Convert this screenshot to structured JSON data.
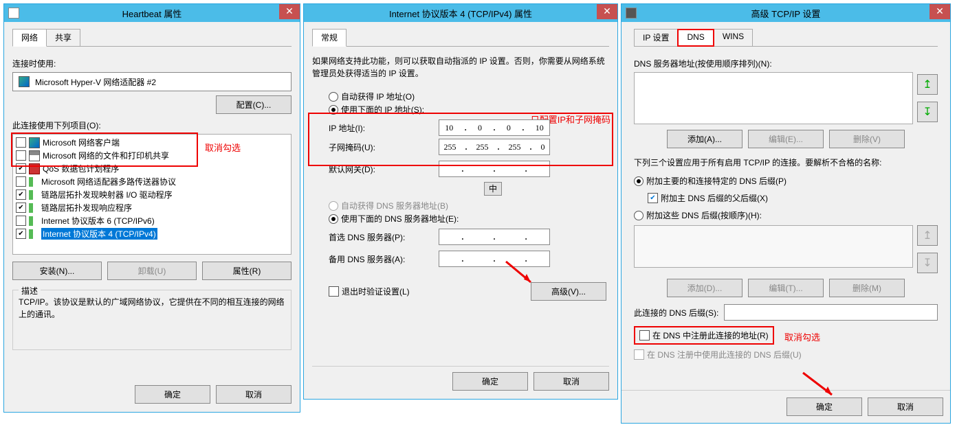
{
  "win1": {
    "title": "Heartbeat 属性",
    "tabs": [
      "网络",
      "共享"
    ],
    "connect_lbl": "连接时使用:",
    "adapter": "Microsoft Hyper-V 网络适配器 #2",
    "config_btn": "配置(C)...",
    "items_lbl": "此连接使用下列项目(O):",
    "note1": "取消勾选",
    "components": [
      {
        "checked": false,
        "icon": "net",
        "text": "Microsoft 网络客户端"
      },
      {
        "checked": false,
        "icon": "prn",
        "text": "Microsoft 网络的文件和打印机共享"
      },
      {
        "checked": true,
        "icon": "red",
        "text": "QoS 数据包计划程序"
      },
      {
        "checked": false,
        "icon": "grn",
        "text": "Microsoft 网络适配器多路传送器协议"
      },
      {
        "checked": true,
        "icon": "grn",
        "text": "链路层拓扑发现映射器 I/O 驱动程序"
      },
      {
        "checked": true,
        "icon": "grn",
        "text": "链路层拓扑发现响应程序"
      },
      {
        "checked": false,
        "icon": "grn",
        "text": "Internet 协议版本 6 (TCP/IPv6)"
      },
      {
        "checked": true,
        "icon": "grn",
        "text": "Internet 协议版本 4 (TCP/IPv4)",
        "selected": true
      }
    ],
    "install": "安装(N)...",
    "uninstall": "卸载(U)",
    "properties": "属性(R)",
    "desc_lbl": "描述",
    "desc": "TCP/IP。该协议是默认的广域网络协议，它提供在不同的相互连接的网络上的通讯。",
    "ok": "确定",
    "cancel": "取消"
  },
  "win2": {
    "title": "Internet 协议版本 4 (TCP/IPv4) 属性",
    "tab": "常规",
    "intro": "如果网络支持此功能，则可以获取自动指派的 IP 设置。否则，你需要从网络系统管理员处获得适当的 IP 设置。",
    "note2": "只配置IP和子网掩码",
    "r1": "自动获得 IP 地址(O)",
    "r2": "使用下面的 IP 地址(S):",
    "ip_lbl": "IP 地址(I):",
    "ip": [
      "10",
      "0",
      "0",
      "10"
    ],
    "mask_lbl": "子网掩码(U):",
    "mask": [
      "255",
      "255",
      "255",
      "0"
    ],
    "gw_lbl": "默认网关(D):",
    "r3": "自动获得 DNS 服务器地址(B)",
    "r4": "使用下面的 DNS 服务器地址(E):",
    "dns1_lbl": "首选 DNS 服务器(P):",
    "dns2_lbl": "备用 DNS 服务器(A):",
    "validate": "退出时验证设置(L)",
    "advanced": "高级(V)...",
    "center_btn": "中",
    "ok": "确定",
    "cancel": "取消"
  },
  "win3": {
    "title": "高级 TCP/IP 设置",
    "tabs": [
      "IP 设置",
      "DNS",
      "WINS"
    ],
    "servers_lbl": "DNS 服务器地址(按使用顺序排列)(N):",
    "add1": "添加(A)...",
    "edit1": "编辑(E)...",
    "del1": "删除(V)",
    "para": "下列三个设置应用于所有启用 TCP/IP 的连接。要解析不合格的名称:",
    "r_a": "附加主要的和连接特定的 DNS 后缀(P)",
    "cb_a": "附加主 DNS 后缀的父后缀(X)",
    "r_b": "附加这些 DNS 后缀(按顺序)(H):",
    "add2": "添加(D)...",
    "edit2": "编辑(T)...",
    "del2": "删除(M)",
    "suffix_lbl": "此连接的 DNS 后缀(S):",
    "reg": "在 DNS 中注册此连接的地址(R)",
    "use_suffix": "在 DNS 注册中使用此连接的 DNS 后缀(U)",
    "note3": "取消勾选",
    "ok": "确定",
    "cancel": "取消"
  }
}
